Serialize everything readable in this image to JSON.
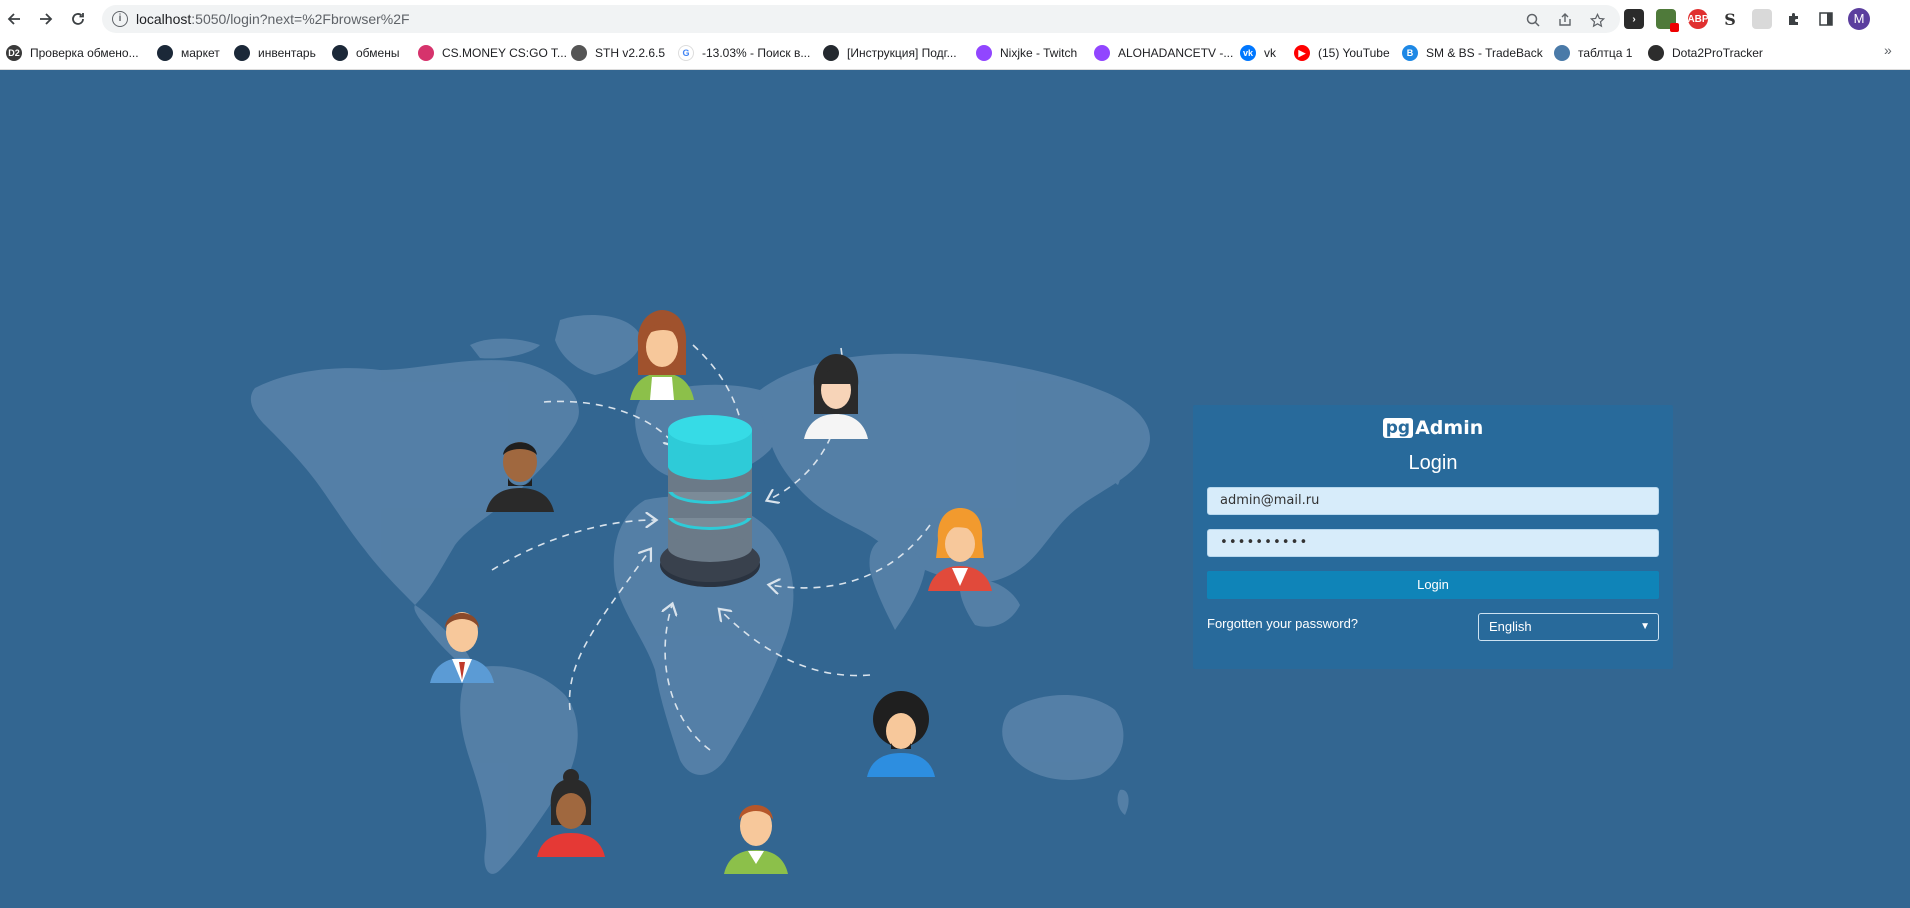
{
  "browser": {
    "url_host": "localhost",
    "url_path": ":5050/login?next=%2Fbrowser%2F",
    "profile_initial": "M",
    "bookmarks": [
      {
        "label": "Проверка обмено...",
        "fav_text": "D2",
        "color": "#3a3a3a"
      },
      {
        "label": "маркет",
        "fav_text": "",
        "color": "#1b2838"
      },
      {
        "label": "инвентарь",
        "fav_text": "",
        "color": "#1b2838"
      },
      {
        "label": "обмены",
        "fav_text": "",
        "color": "#1b2838"
      },
      {
        "label": "CS.MONEY CS:GO T...",
        "fav_text": "",
        "color": "#d6336c"
      },
      {
        "label": "STH v2.2.6.5",
        "fav_text": "",
        "color": "#555555"
      },
      {
        "label": "-13.03% - Поиск в...",
        "fav_text": "G",
        "color": "#ffffff"
      },
      {
        "label": "[Инструкция] Подг...",
        "fav_text": "",
        "color": "#24292f"
      },
      {
        "label": "Nixjke - Twitch",
        "fav_text": "",
        "color": "#9146ff"
      },
      {
        "label": "ALOHADANCETV -...",
        "fav_text": "",
        "color": "#9146ff"
      },
      {
        "label": "vk",
        "fav_text": "vk",
        "color": "#0077ff"
      },
      {
        "label": "(15) YouTube",
        "fav_text": "▶",
        "color": "#ff0000"
      },
      {
        "label": "SM & BS - TradeBack",
        "fav_text": "B",
        "color": "#1e88e5"
      },
      {
        "label": "таблтца 1",
        "fav_text": "",
        "color": "#4a7aa8"
      },
      {
        "label": "Dota2ProTracker",
        "fav_text": "",
        "color": "#2d2d2d"
      }
    ]
  },
  "login": {
    "logo_pg": "pg",
    "logo_admin": "Admin",
    "title": "Login",
    "email_value": "admin@mail.ru",
    "password_value": "••••••••••",
    "button_label": "Login",
    "forgot_label": "Forgotten your password?",
    "language": "English"
  },
  "colors": {
    "background": "#336691",
    "card": "#286a9b",
    "button": "#0f84b8"
  }
}
